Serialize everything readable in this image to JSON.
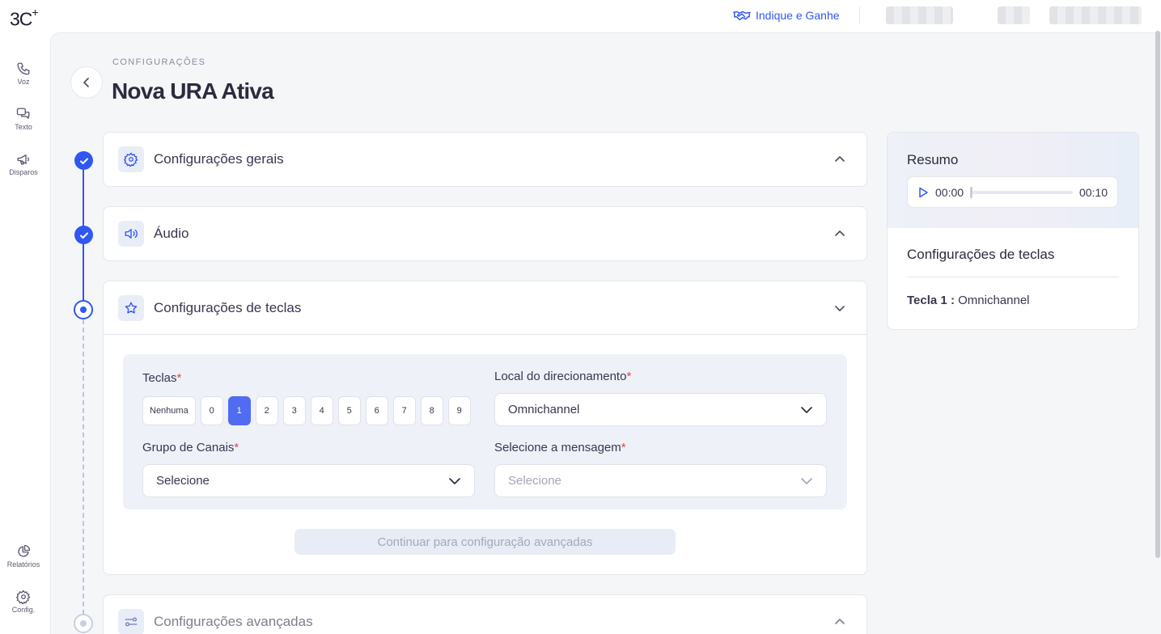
{
  "app": {
    "logo": "3C",
    "logo_sup": "+"
  },
  "header": {
    "invite_label": "Indique e Ganhe"
  },
  "sidebar": {
    "items": [
      {
        "label": "Voz",
        "icon": "phone-icon"
      },
      {
        "label": "Texto",
        "icon": "chat-icon"
      },
      {
        "label": "Disparos",
        "icon": "megaphone-icon"
      },
      {
        "label": "Relatórios",
        "icon": "pie-chart-icon"
      },
      {
        "label": "Config.",
        "icon": "gear-icon"
      }
    ]
  },
  "page": {
    "breadcrumb": "CONFIGURAÇÕES",
    "title": "Nova URA Ativa"
  },
  "steps": [
    {
      "label": "Configurações gerais",
      "status": "done",
      "icon": "gear-icon"
    },
    {
      "label": "Áudio",
      "status": "done",
      "icon": "speaker-icon"
    },
    {
      "label": "Configurações de teclas",
      "status": "active",
      "icon": "star-icon"
    },
    {
      "label": "Configurações avançadas",
      "status": "pending",
      "icon": "sliders-icon"
    }
  ],
  "form": {
    "keys_label": "Teclas",
    "keys": [
      "Nenhuma",
      "0",
      "1",
      "2",
      "3",
      "4",
      "5",
      "6",
      "7",
      "8",
      "9"
    ],
    "selected_key": "1",
    "direction_label": "Local do direcionamento",
    "direction_value": "Omnichannel",
    "group_label": "Grupo de Canais",
    "group_value": "Selecione",
    "message_label": "Selecione a mensagem",
    "message_value": "Selecione",
    "required_mark": "*",
    "continue_label": "Continuar para configuração avançadas"
  },
  "summary": {
    "title": "Resumo",
    "time_current": "00:00",
    "time_total": "00:10",
    "progress": 0,
    "section_title": "Configurações de teclas",
    "row_key": "Tecla 1",
    "row_separator": ":",
    "row_value": "Omnichannel"
  },
  "colors": {
    "accent": "#3057f2",
    "key_selected": "#4f6cf2",
    "required": "#e44646"
  }
}
